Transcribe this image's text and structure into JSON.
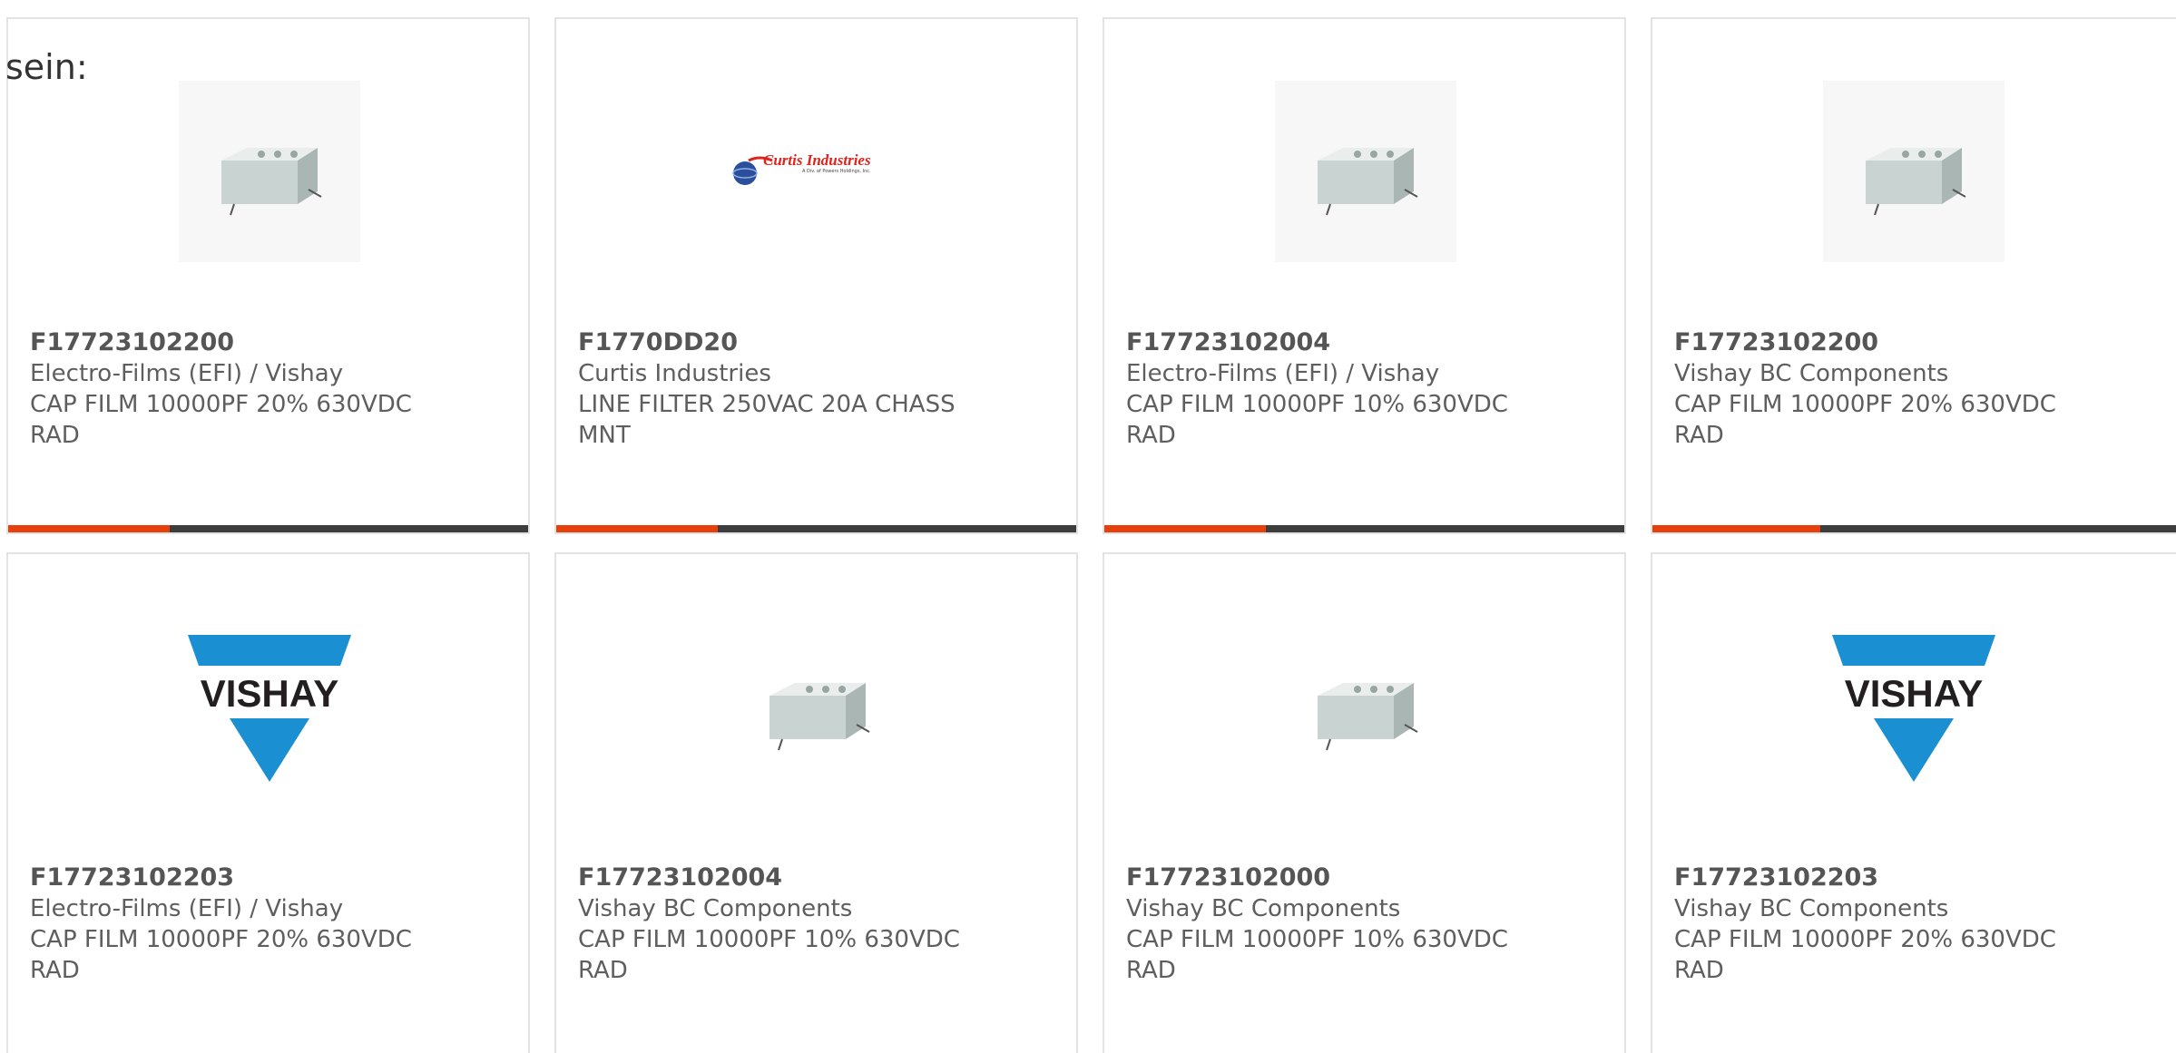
{
  "intro_text": "sein:",
  "colors": {
    "accent": "#e8400c",
    "bar_track": "#3d3d3d",
    "vishay_blue": "#1a8fd1"
  },
  "cards": [
    {
      "part": "F17723102200",
      "mfr": "Electro-Films (EFI) / Vishay",
      "desc1": "CAP FILM 10000PF 20% 630VDC",
      "desc2": "RAD",
      "image": "film-capacitor",
      "progress_pct": 31
    },
    {
      "part": "F1770DD20",
      "mfr": "Curtis Industries",
      "desc1": "LINE FILTER 250VAC 20A CHASS",
      "desc2": "MNT",
      "image": "curtis-industries-logo",
      "logo_text": "Curtis Industries",
      "logo_subtext": "A Div. of Powers Holdings, Inc.",
      "progress_pct": 31
    },
    {
      "part": "F17723102004",
      "mfr": "Electro-Films (EFI) / Vishay",
      "desc1": "CAP FILM 10000PF 10% 630VDC",
      "desc2": "RAD",
      "image": "film-capacitor",
      "progress_pct": 31
    },
    {
      "part": "F17723102200",
      "mfr": "Vishay BC Components",
      "desc1": "CAP FILM 10000PF 20% 630VDC",
      "desc2": "RAD",
      "image": "film-capacitor",
      "progress_pct": 31
    },
    {
      "part": "F17723102203",
      "mfr": "Electro-Films (EFI) / Vishay",
      "desc1": "CAP FILM 10000PF 20% 630VDC",
      "desc2": "RAD",
      "image": "vishay-logo",
      "logo_text": "VISHAY"
    },
    {
      "part": "F17723102004",
      "mfr": "Vishay BC Components",
      "desc1": "CAP FILM 10000PF 10% 630VDC",
      "desc2": "RAD",
      "image": "film-capacitor"
    },
    {
      "part": "F17723102000",
      "mfr": "Vishay BC Components",
      "desc1": "CAP FILM 10000PF 10% 630VDC",
      "desc2": "RAD",
      "image": "film-capacitor"
    },
    {
      "part": "F17723102203",
      "mfr": "Vishay BC Components",
      "desc1": "CAP FILM 10000PF 20% 630VDC",
      "desc2": "RAD",
      "image": "vishay-logo",
      "logo_text": "VISHAY"
    }
  ]
}
